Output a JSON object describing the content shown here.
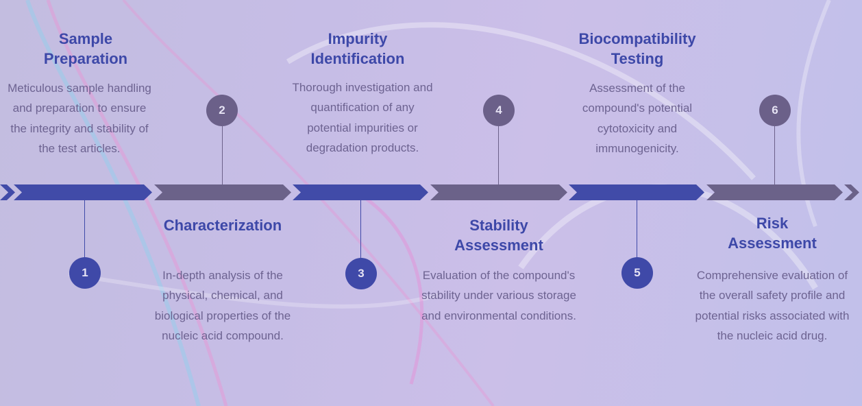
{
  "colors": {
    "accent_blue": "#3f49a8",
    "accent_grey": "#6b6089",
    "title_text": "#3d48a8",
    "body_text": "#6d6391",
    "badge_text": "#e6e3f4"
  },
  "steps": [
    {
      "number": "1",
      "title_line1": "Sample",
      "title_line2": "Preparation",
      "description": "Meticulous sample handling and preparation to ensure the integrity and stability of the test articles.",
      "position": "above",
      "badge_color": "blue"
    },
    {
      "number": "2",
      "title_line1": "Characterization",
      "title_line2": "",
      "description": "In-depth analysis of the physical, chemical, and biological properties of the nucleic acid compound.",
      "position": "below",
      "badge_color": "grey"
    },
    {
      "number": "3",
      "title_line1": "Impurity",
      "title_line2": "Identification",
      "description": "Thorough investigation and quantification of any potential impurities or degradation products.",
      "position": "above",
      "badge_color": "blue"
    },
    {
      "number": "4",
      "title_line1": "Stability",
      "title_line2": "Assessment",
      "description": "Evaluation of the compound's stability under various storage and environmental conditions.",
      "position": "below",
      "badge_color": "grey"
    },
    {
      "number": "5",
      "title_line1": "Biocompatibility",
      "title_line2": "Testing",
      "description": "Assessment of the compound's potential cytotoxicity and immunogenicity.",
      "position": "above",
      "badge_color": "blue"
    },
    {
      "number": "6",
      "title_line1": "Risk",
      "title_line2": "Assessment",
      "description": "Comprehensive evaluation of the overall safety profile and potential risks associated with the nucleic acid drug.",
      "position": "below",
      "badge_color": "grey"
    }
  ]
}
